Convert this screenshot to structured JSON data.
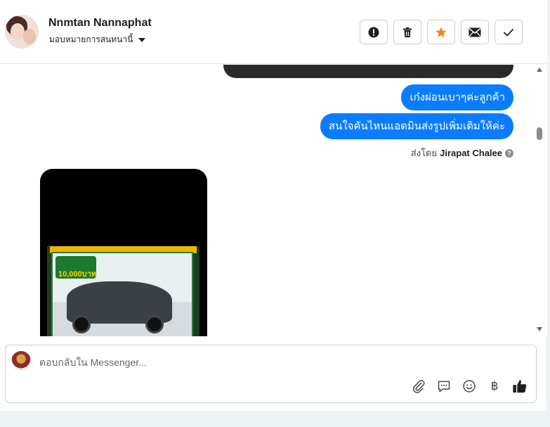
{
  "header": {
    "name": "Nnmtan Nannaphat",
    "assign_label": "มอบหมายการสนทนานี้"
  },
  "actions": [
    {
      "icon": "alert-icon"
    },
    {
      "icon": "trash-icon"
    },
    {
      "icon": "star-icon",
      "color": "#f5821f"
    },
    {
      "icon": "mail-icon"
    },
    {
      "icon": "check-icon"
    }
  ],
  "thread": {
    "messages": [
      {
        "text": "เก๋งผ่อนเบาๆค่ะลูกค้า"
      },
      {
        "text": "สนใจคันไหนแอดมินส่งรูปเพิ่มเติมให้ค่ะ"
      }
    ],
    "sent_by_label": "ส่งโดย",
    "sent_by_name": "Jirapat Chalee",
    "promo_text": "10,000บาท"
  },
  "composer": {
    "placeholder": "ตอบกลับใน Messenger..."
  },
  "colors": {
    "bubble": "#0a7cff",
    "star": "#f5821f"
  }
}
